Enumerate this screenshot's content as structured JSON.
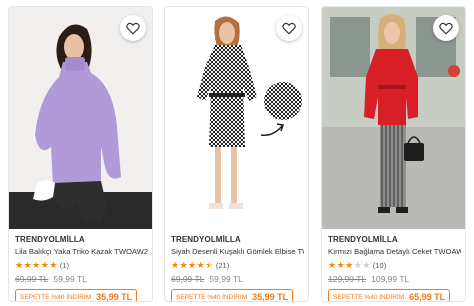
{
  "products": [
    {
      "brand": "TRENDYOLMİLLA",
      "name": "Lila Balıkçı Yaka Triko Kazak TWOAW20K...",
      "rating_count": "(1)",
      "stars_filled": 5,
      "old_price": "69,99 TL",
      "price": "59,99 TL",
      "promo_label": "SEPETTE %40 İNDİRİM",
      "promo_price": "35,99 TL",
      "favorite_icon": "heart-icon"
    },
    {
      "brand": "TRENDYOLMİLLA",
      "name": "Siyah Desenli Kuşaklı Gömlek Elbise TW...",
      "rating_count": "(21)",
      "stars_filled": 4.5,
      "old_price": "69,99 TL",
      "price": "59,99 TL",
      "promo_label": "SEPETTE %40 İNDİRİM",
      "promo_price": "35,99 TL",
      "favorite_icon": "heart-icon"
    },
    {
      "brand": "TRENDYOLMİLLA",
      "name": "Kırmızı Bağlama Detaylı Ceket TWOAW2...",
      "rating_count": "(10)",
      "stars_filled": 3,
      "old_price": "129,99 TL",
      "price": "109,99 TL",
      "promo_label": "SEPETTE %40 İNDİRİM",
      "promo_price": "65,99 TL",
      "favorite_icon": "heart-icon"
    }
  ],
  "colors": {
    "accent": "#f27a1a",
    "star": "#f28b00"
  }
}
